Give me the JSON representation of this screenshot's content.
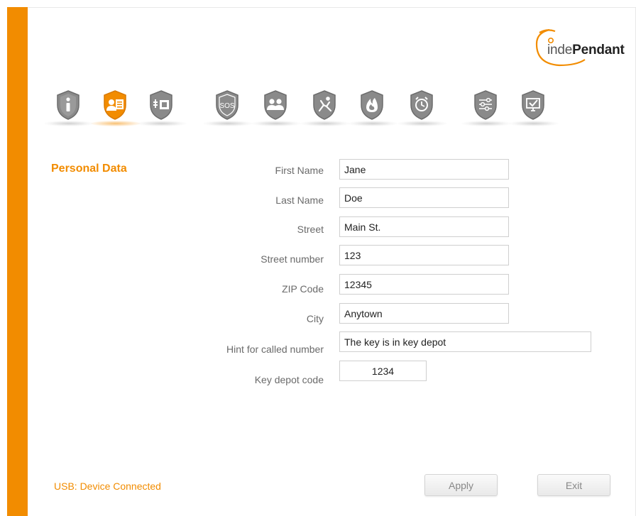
{
  "brand": {
    "logo_prefix": "inde",
    "logo_suffix": "Pendant",
    "accent": "#f28c00"
  },
  "toolbar": {
    "items": [
      {
        "name": "info-icon",
        "active": false
      },
      {
        "name": "personal-data-icon",
        "active": true
      },
      {
        "name": "phone-connection-icon",
        "active": false
      },
      {
        "name": "sos-icon",
        "active": false,
        "label": "SOS"
      },
      {
        "name": "contacts-icon",
        "active": false
      },
      {
        "name": "fall-detection-icon",
        "active": false
      },
      {
        "name": "fire-alarm-icon",
        "active": false
      },
      {
        "name": "alarm-clock-icon",
        "active": false
      },
      {
        "name": "settings-sliders-icon",
        "active": false
      },
      {
        "name": "monitor-check-icon",
        "active": false
      }
    ]
  },
  "section": {
    "title": "Personal Data"
  },
  "form": {
    "first_name": {
      "label": "First Name",
      "value": "Jane"
    },
    "last_name": {
      "label": "Last Name",
      "value": "Doe"
    },
    "street": {
      "label": "Street",
      "value": "Main St."
    },
    "street_number": {
      "label": "Street number",
      "value": "123"
    },
    "zip": {
      "label": "ZIP Code",
      "value": "12345"
    },
    "city": {
      "label": "City",
      "value": "Anytown"
    },
    "hint": {
      "label": "Hint for called number",
      "value": "The key is in key depot"
    },
    "key_depot": {
      "label": "Key depot code",
      "value": "1234"
    }
  },
  "footer": {
    "status": "USB: Device Connected",
    "apply_label": "Apply",
    "exit_label": "Exit"
  }
}
